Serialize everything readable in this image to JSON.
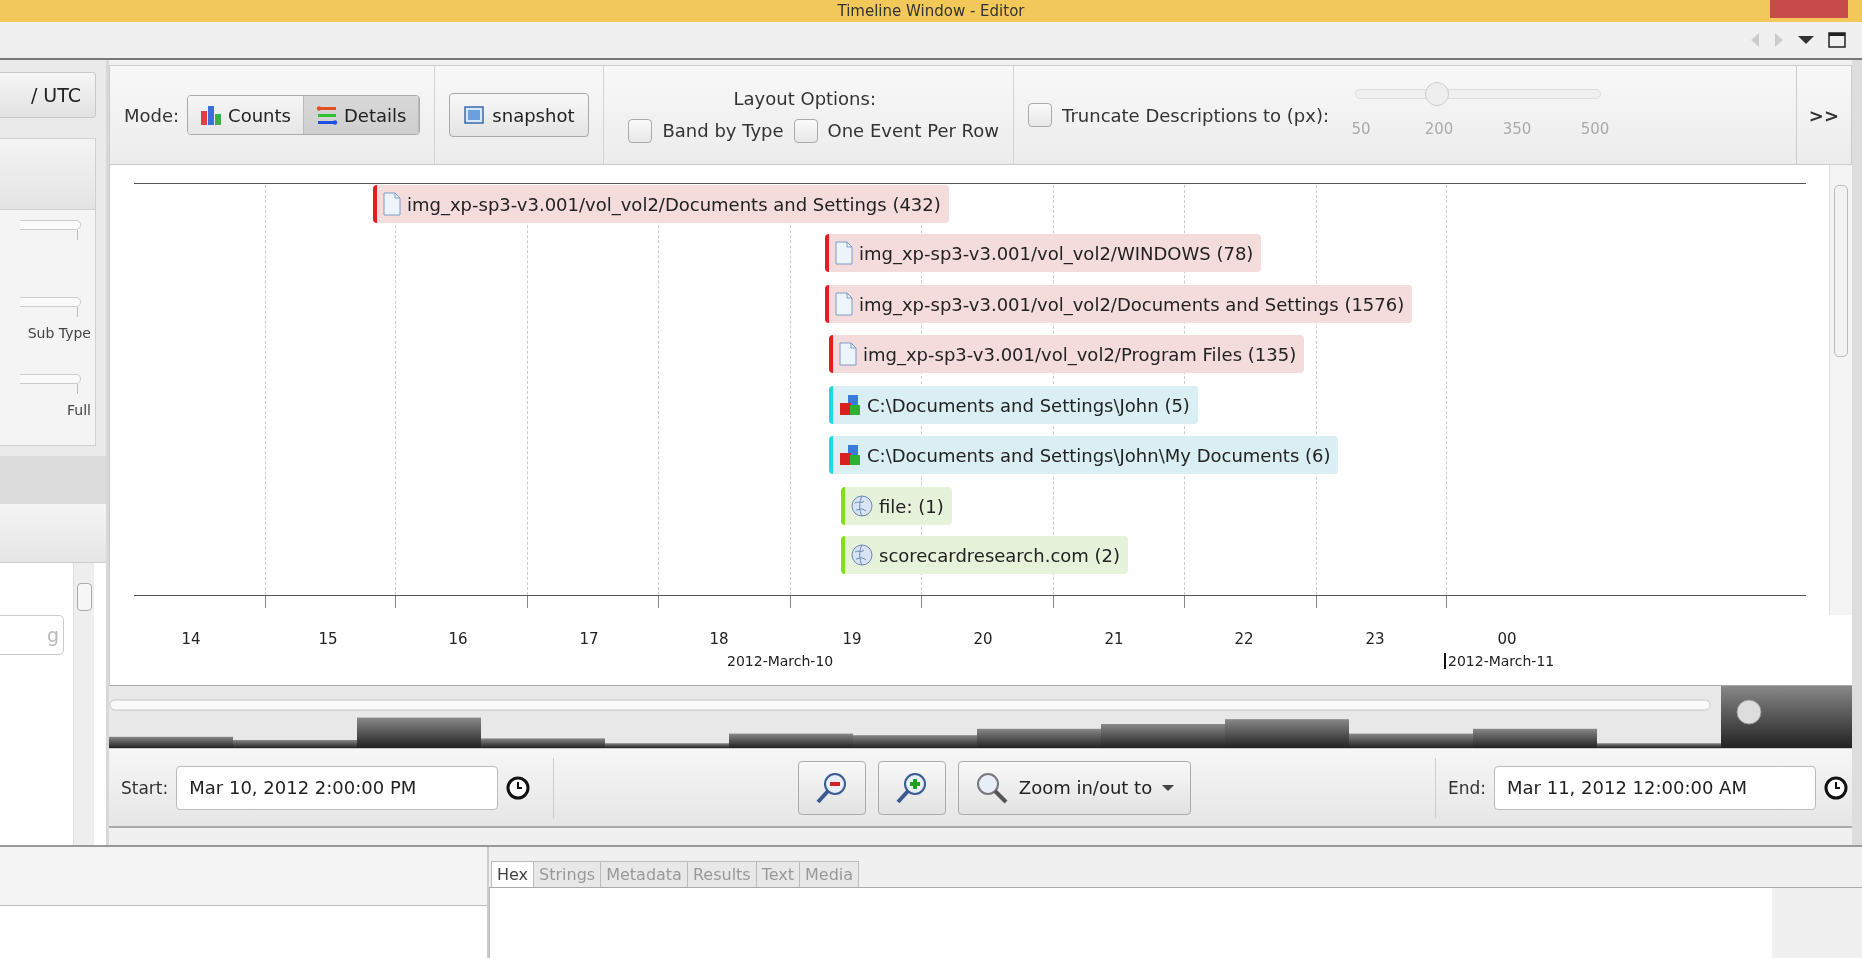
{
  "window": {
    "title": "Timeline Window - Editor"
  },
  "left_panel": {
    "timezone_button": "/ UTC",
    "slider_labels": [
      "Sub Type",
      "Full"
    ],
    "filter_field": {
      "placeholder": "g"
    }
  },
  "toolbar": {
    "mode_label": "Mode:",
    "modes": [
      {
        "label": "Counts",
        "kind": "counts",
        "selected": false
      },
      {
        "label": "Details",
        "kind": "details",
        "selected": true
      }
    ],
    "snapshot_button": "snapshot",
    "layout_title": "Layout Options:",
    "layout_options": [
      {
        "label": "Band by Type",
        "checked": false
      },
      {
        "label": "One Event Per Row",
        "checked": false
      }
    ],
    "truncate": {
      "label": "Truncate Descriptions to (px):",
      "checked": false,
      "level": 0.333,
      "ticks": [
        "50",
        "200",
        "350",
        "500"
      ]
    },
    "overflow_button": ">>"
  },
  "events": [
    {
      "label": "img_xp-sp3-v3.001/vol_vol2/Documents and Settings (432)",
      "kind": "file",
      "color": "#e02020"
    },
    {
      "label": "img_xp-sp3-v3.001/vol_vol2/WINDOWS (78)",
      "kind": "file",
      "color": "#e02020"
    },
    {
      "label": "img_xp-sp3-v3.001/vol_vol2/Documents and Settings (1576)",
      "kind": "file",
      "color": "#e02020"
    },
    {
      "label": "img_xp-sp3-v3.001/vol_vol2/Program Files (135)",
      "kind": "file",
      "color": "#e02020"
    },
    {
      "label": "C:\\Documents and Settings\\John (5)",
      "kind": "registry",
      "color": "#20d8e0"
    },
    {
      "label": "C:\\Documents and Settings\\John\\My Documents (6)",
      "kind": "registry",
      "color": "#20d8e0"
    },
    {
      "label": "file: (1)",
      "kind": "web",
      "color": "#80e020"
    },
    {
      "label": "scorecardresearch.com (2)",
      "kind": "web",
      "color": "#80e020"
    }
  ],
  "axis": {
    "ticks": [
      "14",
      "15",
      "16",
      "17",
      "18",
      "19",
      "20",
      "21",
      "22",
      "23",
      "00"
    ],
    "dates": [
      "2012-March-10",
      "2012-March-11"
    ]
  },
  "range": {
    "start_label": "Start:",
    "start": "Mar 10, 2012 2:00:00 PM",
    "zoom_menu": "Zoom in/out to",
    "end_label": "End:",
    "end": "Mar 11, 2012 12:00:00 AM"
  },
  "viewer_tabs": [
    {
      "label": "Hex",
      "selected": true
    },
    {
      "label": "Strings",
      "selected": false
    },
    {
      "label": "Metadata",
      "selected": false
    },
    {
      "label": "Results",
      "selected": false
    },
    {
      "label": "Text",
      "selected": false
    },
    {
      "label": "Media",
      "selected": false
    }
  ]
}
